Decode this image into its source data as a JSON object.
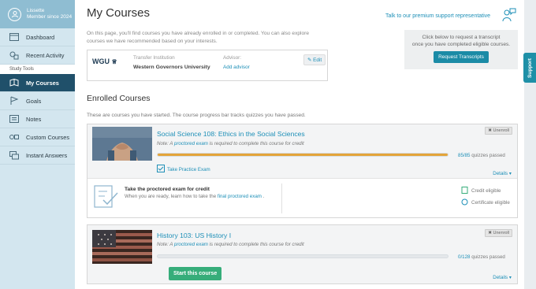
{
  "user": {
    "name": "Lissette",
    "member_since": "Member since 2024"
  },
  "nav": {
    "items": [
      {
        "label": "Dashboard",
        "icon": "dashboard-icon"
      },
      {
        "label": "Recent Activity",
        "icon": "activity-icon"
      }
    ],
    "section_label": "Study Tools",
    "study_items": [
      {
        "label": "My Courses",
        "icon": "courses-icon",
        "active": true
      },
      {
        "label": "Goals",
        "icon": "goals-icon"
      },
      {
        "label": "Notes",
        "icon": "notes-icon"
      },
      {
        "label": "Custom Courses",
        "icon": "custom-courses-icon"
      },
      {
        "label": "Instant Answers",
        "icon": "instant-answers-icon"
      }
    ]
  },
  "page": {
    "title": "My Courses",
    "support_link": "Talk to our premium support representative",
    "intro": "On this page, you'll find courses you have already enrolled in or completed. You can also explore courses we have recommended based on your interests."
  },
  "transcript": {
    "text_line1": "Click below to request a transcript",
    "text_line2": "once you have completed eligible courses.",
    "button": "Request Transcripts"
  },
  "institution": {
    "logo_text": "WGU",
    "transfer_label": "Transfer Institution",
    "transfer_value": "Western Governors University",
    "advisor_label": "Advisor:",
    "advisor_action": "Add advisor",
    "edit_label": "Edit"
  },
  "enrolled": {
    "title": "Enrolled Courses",
    "subtitle": "These are courses you have started. The course progress bar tracks quizzes you have passed."
  },
  "courses": [
    {
      "title": "Social Science 108: Ethics in the Social Sciences",
      "note_prefix": "Note: A",
      "note_link": "proctored exam",
      "note_suffix": "is required to complete this course for credit",
      "progress": 1.0,
      "quiz_count": "85/85",
      "quiz_label": "quizzes passed",
      "unenroll": "Unenroll",
      "practice": "Take Practice Exam",
      "details": "Details",
      "exam_title": "Take the proctored exam for credit",
      "exam_text": "When you are ready, learn how to take the",
      "exam_link": "final proctored exam",
      "exam_end": ".",
      "credit_eligible": "Credit eligible",
      "certificate_eligible": "Certificate eligible"
    },
    {
      "title": "History 103: US History I",
      "note_prefix": "Note: A",
      "note_link": "proctored exam",
      "note_suffix": "is required to complete this course for credit",
      "progress": 0.0,
      "quiz_count": "0/128",
      "quiz_label": "quizzes passed",
      "unenroll": "Unenroll",
      "start": "Start this course",
      "details": "Details"
    }
  ],
  "support_tab": "Support",
  "colors": {
    "accent": "#1d8fb7",
    "sidebar": "#d3e6ef",
    "nav_active": "#20506a",
    "progress": "#e3a43a",
    "start_button": "#36ad7a"
  }
}
